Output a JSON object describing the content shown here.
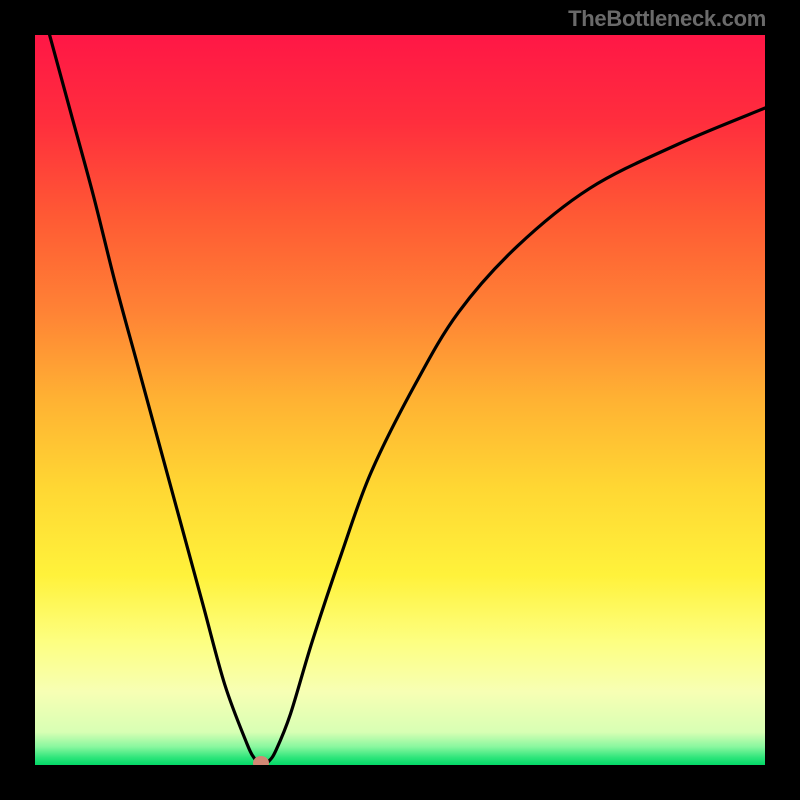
{
  "watermark_text": "TheBottleneck.com",
  "chart_data": {
    "type": "line",
    "title": "",
    "xlabel": "",
    "ylabel": "",
    "xlim": [
      0,
      100
    ],
    "ylim": [
      0,
      100
    ],
    "series": [
      {
        "name": "bottleneck-curve",
        "x": [
          2,
          5,
          8,
          11,
          14,
          17,
          20,
          23,
          26,
          29,
          30,
          31,
          32,
          33,
          35,
          38,
          42,
          46,
          52,
          58,
          66,
          76,
          88,
          100
        ],
        "y": [
          100,
          89,
          78,
          66,
          55,
          44,
          33,
          22,
          11,
          3,
          1,
          0,
          0.5,
          2,
          7,
          17,
          29,
          40,
          52,
          62,
          71,
          79,
          85,
          90
        ]
      }
    ],
    "marker": {
      "name": "optimal-point",
      "x": 31,
      "y": 0,
      "color": "#d28774"
    },
    "gradient_stops": [
      {
        "offset": 0.0,
        "color": "#ff1746"
      },
      {
        "offset": 0.12,
        "color": "#ff2e3d"
      },
      {
        "offset": 0.25,
        "color": "#ff5a34"
      },
      {
        "offset": 0.38,
        "color": "#ff8335"
      },
      {
        "offset": 0.5,
        "color": "#ffb233"
      },
      {
        "offset": 0.62,
        "color": "#ffd733"
      },
      {
        "offset": 0.74,
        "color": "#fff23b"
      },
      {
        "offset": 0.83,
        "color": "#fdff80"
      },
      {
        "offset": 0.9,
        "color": "#f7ffb4"
      },
      {
        "offset": 0.955,
        "color": "#d8ffb4"
      },
      {
        "offset": 0.975,
        "color": "#89f79f"
      },
      {
        "offset": 0.99,
        "color": "#2de57a"
      },
      {
        "offset": 1.0,
        "color": "#03d867"
      }
    ]
  }
}
